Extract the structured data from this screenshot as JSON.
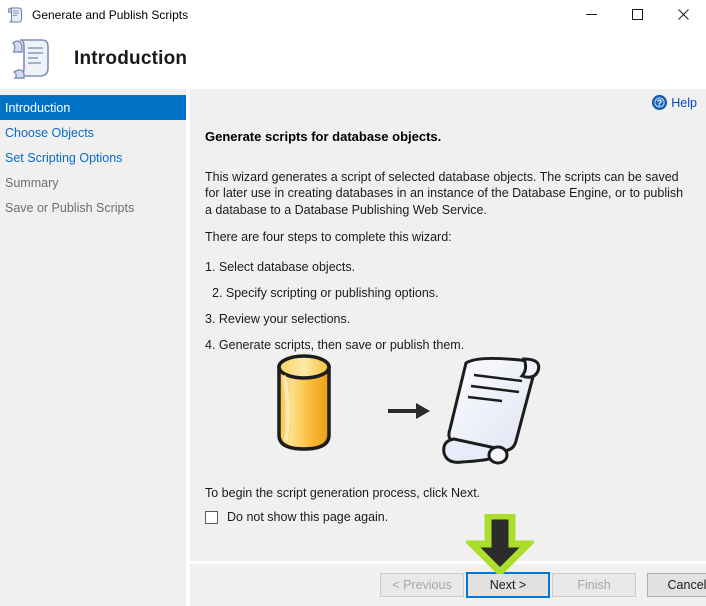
{
  "window": {
    "title": "Generate and Publish Scripts",
    "icon": "script-scroll-icon",
    "controls": {
      "minimize": "minimize-icon",
      "maximize": "maximize-icon",
      "close": "close-icon"
    }
  },
  "header": {
    "title": "Introduction",
    "icon": "script-scroll-large-icon"
  },
  "sidebar": {
    "items": [
      {
        "label": "Introduction",
        "state": "selected"
      },
      {
        "label": "Choose Objects",
        "state": "link"
      },
      {
        "label": "Set Scripting Options",
        "state": "link"
      },
      {
        "label": "Summary",
        "state": "disabled"
      },
      {
        "label": "Save or Publish Scripts",
        "state": "disabled"
      }
    ]
  },
  "content": {
    "help_label": "Help",
    "help_icon": "help-question-icon",
    "heading": "Generate scripts for database objects.",
    "intro_paragraph": "This wizard generates a script of selected database objects. The scripts can be saved for later use in creating databases in an instance of the Database Engine, or to publish a database to a Database Publishing Web Service.",
    "steps_lead": "There are four steps to complete this wizard:",
    "steps": [
      "1. Select database objects.",
      "2. Specify scripting or publishing options.",
      "3. Review your selections.",
      "4. Generate scripts, then save or publish them."
    ],
    "illustration": {
      "source_icon": "database-cylinder-icon",
      "arrow_icon": "right-arrow-icon",
      "target_icon": "script-scroll-document-icon"
    },
    "begin_text": "To begin the script generation process, click Next.",
    "checkbox": {
      "label": "Do not show this page again.",
      "checked": false
    }
  },
  "buttons": {
    "previous": {
      "label": "< Previous",
      "enabled": false
    },
    "next": {
      "label": "Next >",
      "enabled": true,
      "focused": true
    },
    "finish": {
      "label": "Finish",
      "enabled": false
    },
    "cancel": {
      "label": "Cancel",
      "enabled": true
    }
  },
  "annotation": {
    "arrow": "down-arrow-annotation",
    "target": "next-button",
    "outline_color": "#aade2b",
    "fill_color": "#2b2b2b"
  },
  "colors": {
    "selected_sidebar": "#0072c6",
    "link": "#0a6ac7",
    "panel_bg": "#f0f0f0",
    "focus_ring": "#0078d7"
  }
}
